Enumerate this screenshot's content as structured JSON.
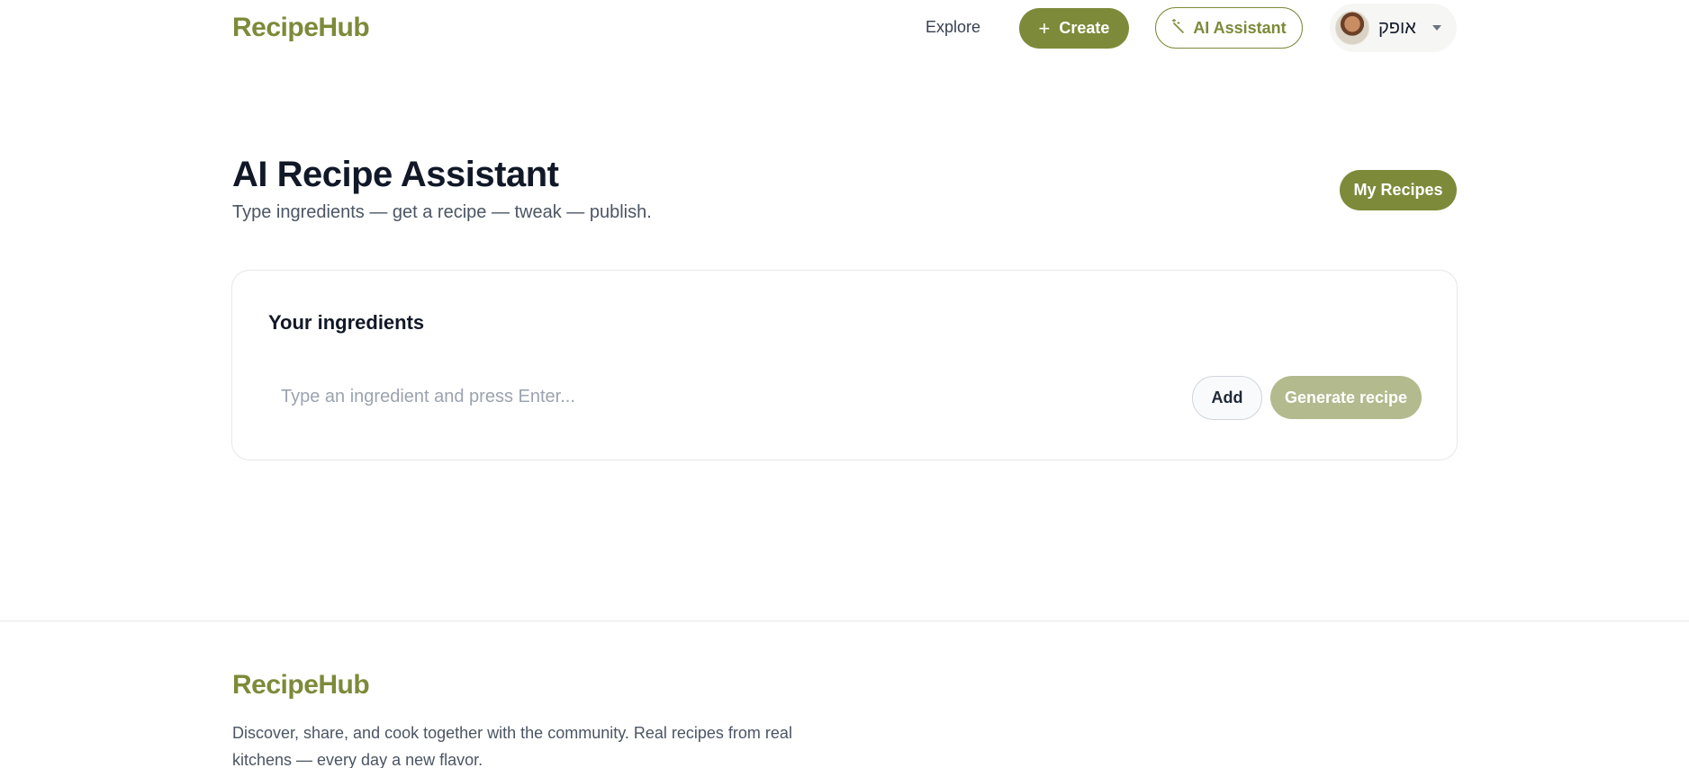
{
  "header": {
    "logo": "RecipeHub",
    "nav_explore": "Explore",
    "create_label": "Create",
    "create_icon": "plus-icon",
    "ai_label": "AI Assistant",
    "ai_icon": "magic-wand-icon",
    "user_name": "אופק"
  },
  "main": {
    "title": "AI Recipe Assistant",
    "subtitle": "Type ingredients — get a recipe — tweak — publish.",
    "my_recipes_label": "My Recipes"
  },
  "ingredients_card": {
    "title": "Your ingredients",
    "input_placeholder": "Type an ingredient and press Enter...",
    "input_value": "",
    "add_label": "Add",
    "generate_label": "Generate recipe"
  },
  "footer": {
    "logo": "RecipeHub",
    "description": "Discover, share, and cook together with the community. Real recipes from real kitchens — every day a new flavor."
  },
  "colors": {
    "brand": "#7d8a3a",
    "brand_disabled": "#b2ba8e",
    "text_primary": "#111827",
    "text_secondary": "#4b5563"
  }
}
